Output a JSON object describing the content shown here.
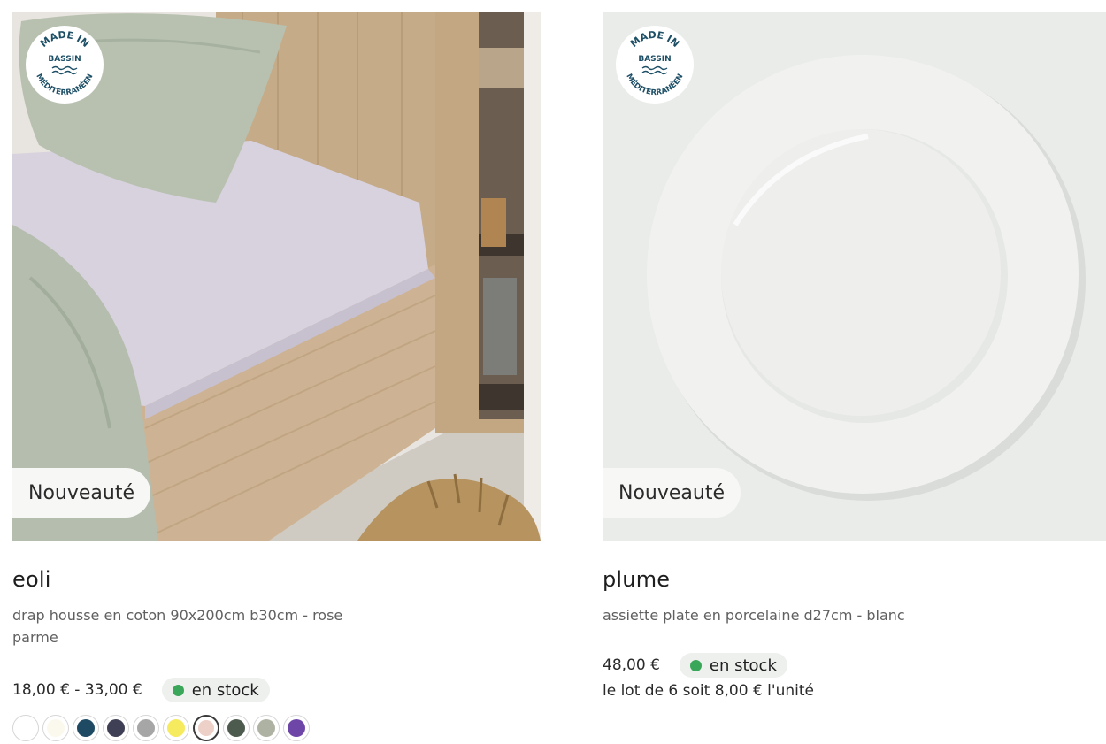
{
  "products": [
    {
      "name": "eoli",
      "description": "drap housse en coton 90x200cm b30cm - rose parme",
      "price": "18,00 € - 33,00 €",
      "stock": "en stock",
      "tag": "Nouveauté",
      "badge": {
        "top": "MADE IN",
        "middle": "BASSIN",
        "bottom": "MÉDITERRANÉEN"
      },
      "swatches": [
        "#ffffff",
        "#fbf9ee",
        "#1e4a64",
        "#3f3f55",
        "#a6a6a6",
        "#f6ea5e",
        "#edd0c8",
        "#4d5b4e",
        "#aeb2a2",
        "#6d46a8"
      ],
      "selected_swatch": 6
    },
    {
      "name": "plume",
      "description": "assiette plate en porcelaine d27cm - blanc",
      "price": "48,00 €",
      "stock": "en stock",
      "unit_note": "le lot de 6 soit 8,00 € l'unité",
      "tag": "Nouveauté",
      "badge": {
        "top": "MADE IN",
        "middle": "BASSIN",
        "bottom": "MÉDITERRANÉEN"
      }
    }
  ],
  "colors": {
    "stock_dot": "#3aa65a",
    "badge_text": "#1d4f66"
  }
}
